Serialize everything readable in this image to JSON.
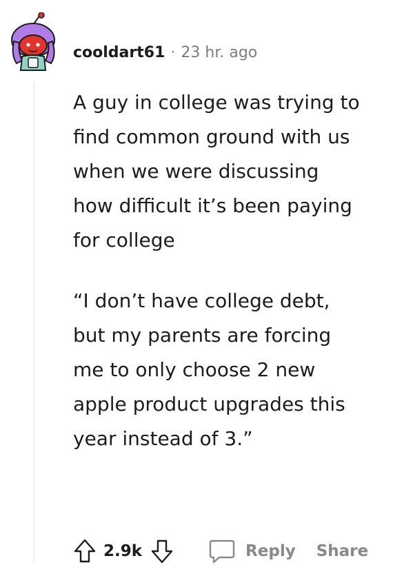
{
  "comment": {
    "author": "cooldart61",
    "separator": "·",
    "timestamp": "23 hr. ago",
    "paragraphs": [
      "A guy in college was trying to find common ground with us when we were discussing how difficult it’s been paying for college",
      "“I don’t have college debt, but my parents are forcing me to only choose 2 new apple product upgrades this year instead of 3.”"
    ]
  },
  "actions": {
    "score": "2.9k",
    "reply_label": "Reply",
    "share_label": "Share"
  },
  "colors": {
    "text": "#1c1c1c",
    "muted": "#878a8c",
    "thread_line": "#edeff1",
    "avatar_hair": "#b07de8",
    "avatar_face": "#e2342a"
  }
}
